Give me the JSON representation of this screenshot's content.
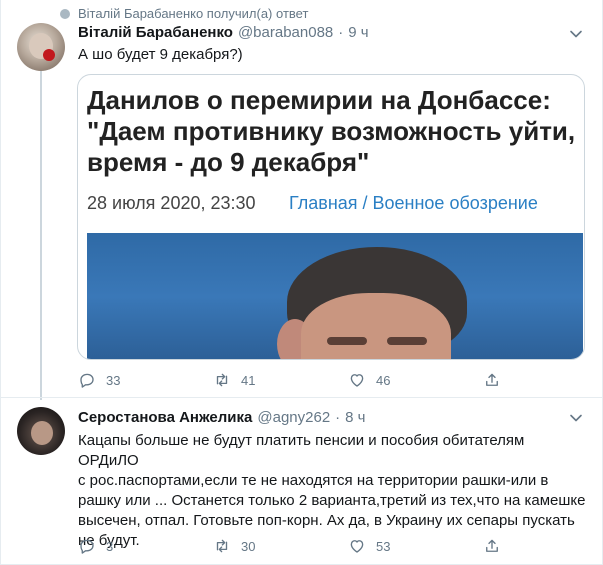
{
  "context": {
    "text": "Віталій Барабаненко получил(а) ответ",
    "icon": "user-icon"
  },
  "tweet1": {
    "display_name": "Віталій Барабаненко",
    "handle": "@baraban088",
    "separator": "·",
    "time": "9 ч",
    "text": "А шо будет 9 декабря?)",
    "card": {
      "title": "Данилов о перемирии на Донбассе: \"Даем противнику возможность уйти, время - до 9 декабря\"",
      "date": "28 июля 2020, 23:30",
      "categories": "Главная / Военное обозрение"
    },
    "actions": {
      "replies": "33",
      "retweets": "41",
      "likes": "46"
    }
  },
  "tweet2": {
    "display_name": "Серостанова Анжелика",
    "handle": "@agny262",
    "separator": "·",
    "time": "8 ч",
    "lines": [
      "Кацапы больше не будут платить пенсии и пособия обитателям ОРДиЛО",
      "с рос.паспортами,если те не находятся на территории рашки-или в",
      "рашку или ... Останется только 2 варианта,третий из тех,что на камешке",
      "высечен, отпал. Готовьте поп-корн. Ах да, в Украину их сепары пускать",
      "не будут."
    ],
    "actions": {
      "replies": "3",
      "retweets": "30",
      "likes": "53"
    }
  },
  "colors": {
    "muted": "#657786",
    "link": "#2a7fc4",
    "border": "#e6ecf0"
  }
}
